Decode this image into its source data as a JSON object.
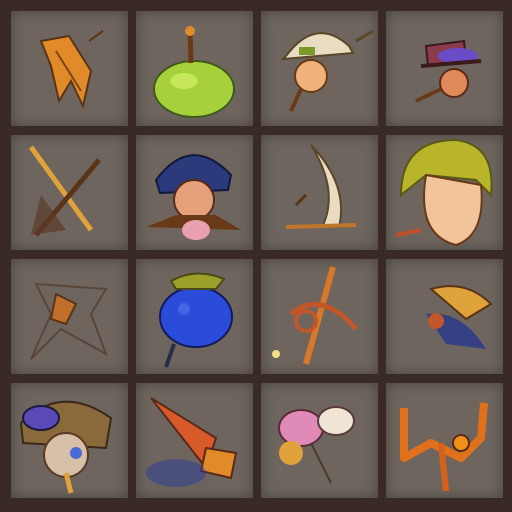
{
  "sheet": {
    "background_color": "#3a2a26",
    "tile_color": "#6e665e",
    "columns": 4,
    "rows": 4
  },
  "tiles": [
    {
      "icon": "orange-leaf-icon"
    },
    {
      "icon": "green-fruit-icon"
    },
    {
      "icon": "miner-character-icon"
    },
    {
      "icon": "hat-character-icon"
    },
    {
      "icon": "crossed-swords-icon"
    },
    {
      "icon": "blue-hat-character-icon"
    },
    {
      "icon": "blade-icon"
    },
    {
      "icon": "blonde-character-icon"
    },
    {
      "icon": "brown-leaf-icon"
    },
    {
      "icon": "blue-fruit-icon"
    },
    {
      "icon": "pickaxe-icon"
    },
    {
      "icon": "feathered-creature-icon"
    },
    {
      "icon": "goggles-character-icon"
    },
    {
      "icon": "rocket-icon"
    },
    {
      "icon": "candy-icon"
    },
    {
      "icon": "orange-rune-icon"
    }
  ]
}
